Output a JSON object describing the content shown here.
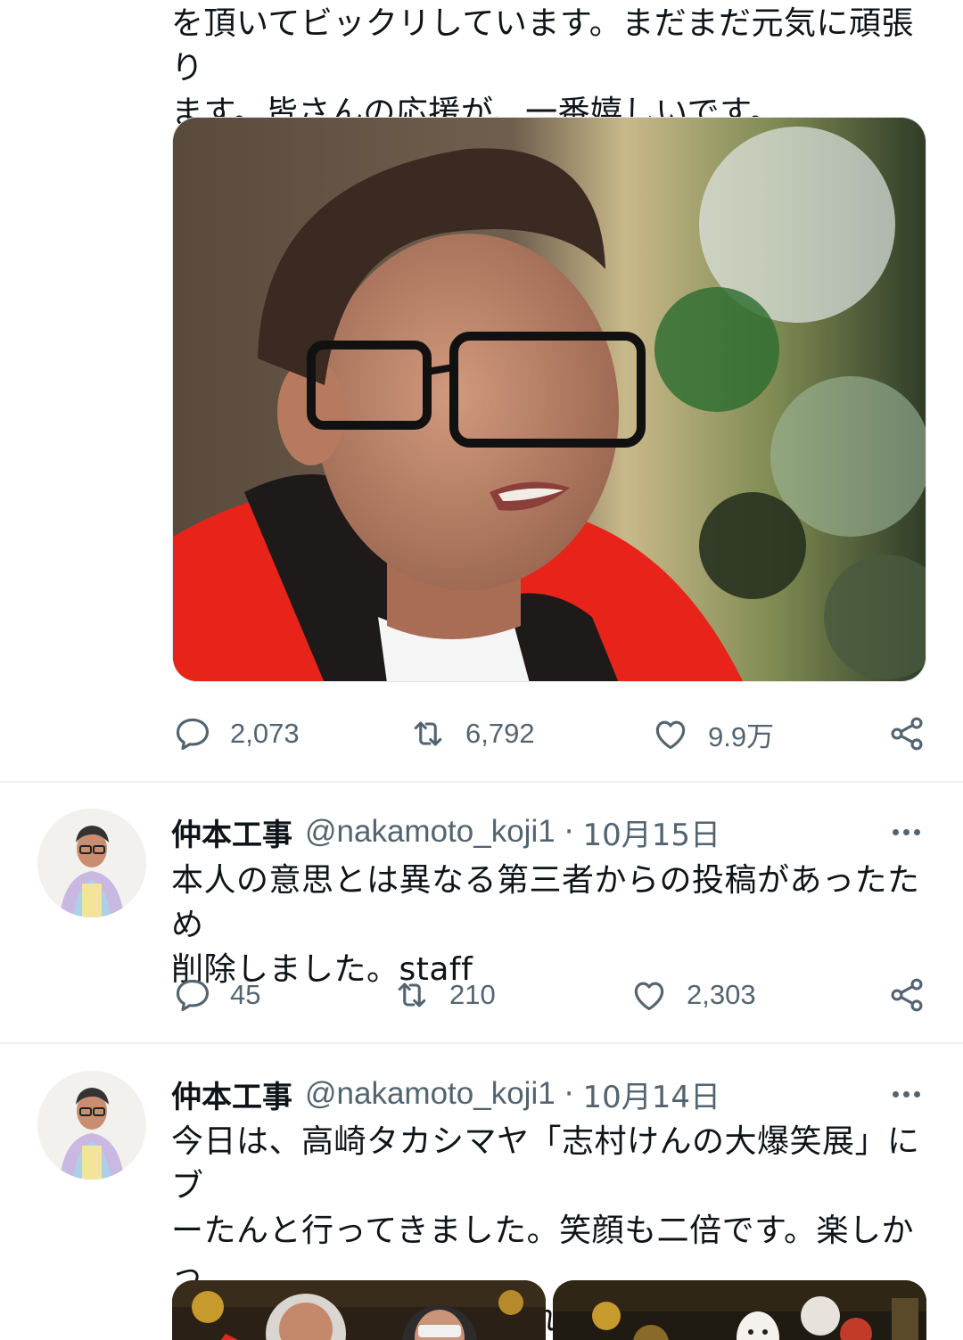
{
  "tweets": [
    {
      "text": "を頂いてビックリしています。まだまだ元気に頑張り\nます。皆さんの応援が、一番嬉しいです。",
      "photo_icon": "portrait-photo",
      "reply_count": "2,073",
      "retweet_count": "6,792",
      "like_count": "9.9万"
    },
    {
      "name": "仲本工事",
      "handle": "@nakamoto_koji1",
      "separator": "·",
      "date": "10月15日",
      "text": "本人の意思とは異なる第三者からの投稿があったため\n削除しました。staff",
      "reply_count": "45",
      "retweet_count": "210",
      "like_count": "2,303"
    },
    {
      "name": "仲本工事",
      "handle": "@nakamoto_koji1",
      "separator": "·",
      "date": "10月14日",
      "text": "今日は、高崎タカシマヤ「志村けんの大爆笑展」にブ\nーたんと行ってきました。笑顔も二倍です。楽しかっ\nたなァ。志村も喜んでくれたかな。"
    }
  ],
  "icons": {
    "reply": "reply-icon",
    "retweet": "retweet-icon",
    "like": "heart-icon",
    "share": "share-icon",
    "more": "more-icon"
  },
  "colors": {
    "text": "#0f1419",
    "secondary": "#536471",
    "divider": "#eef1f3"
  }
}
